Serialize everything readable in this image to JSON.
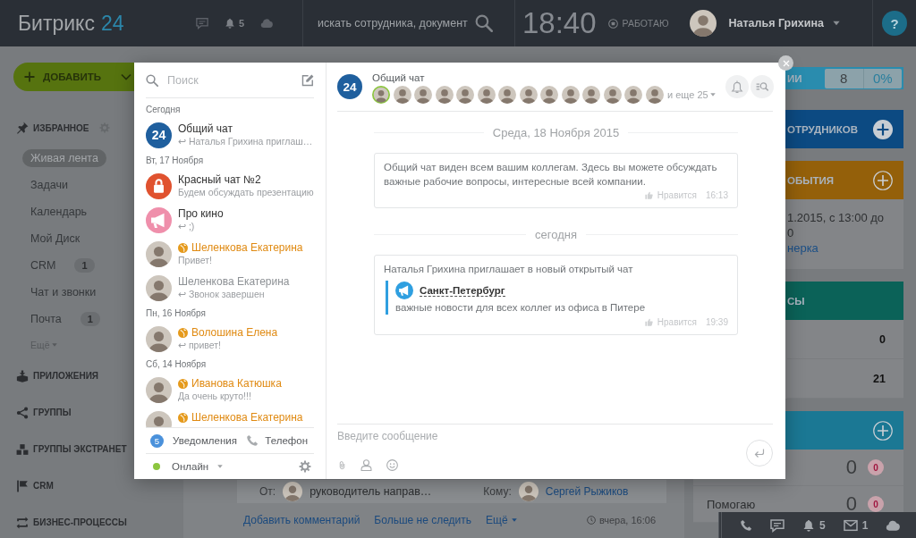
{
  "top_bar": {
    "logo": {
      "name": "Битрикс",
      "number": "24"
    },
    "notifications_count": "5",
    "search": {
      "placeholder": "искать сотрудника, документ"
    },
    "time": "18:40",
    "work_status": "РАБОТАЮ",
    "user": "Наталья Грихина",
    "help": "?"
  },
  "sidebar": {
    "add_button": "ДОБАВИТЬ",
    "favorites": {
      "title": "ИЗБРАННОЕ",
      "items": [
        {
          "label": "Живая лента",
          "selected": true
        },
        {
          "label": "Задачи",
          "selected": false
        },
        {
          "label": "Календарь",
          "selected": false
        },
        {
          "label": "Мой Диск",
          "selected": false
        },
        {
          "label": "CRM",
          "selected": false,
          "counter": "1"
        },
        {
          "label": "Чат и звонки",
          "selected": false
        },
        {
          "label": "Почта",
          "selected": false,
          "counter": "1"
        }
      ],
      "more": "Ещё"
    },
    "sections": [
      "ПРИЛОЖЕНИЯ",
      "ГРУППЫ",
      "ГРУППЫ ЭКСТРАНЕТ",
      "CRM",
      "БИЗНЕС-ПРОЦЕССЫ"
    ]
  },
  "feed_post": {
    "from_label": "От:",
    "from_role": "руководитель направ…",
    "to_label": "Кому:",
    "to_name": "Сергей Рыжиков",
    "actions": [
      "Добавить комментарий",
      "Больше не следить"
    ],
    "more": "Ещё",
    "time": "вчера, 16:06"
  },
  "right_column": {
    "widgets": [
      {
        "kind": "bar",
        "title": "ИИ",
        "color": "#2a8cae",
        "stats": [
          "8",
          "0%"
        ],
        "add": false
      },
      {
        "kind": "bar",
        "title": "ОТРУДНИКОВ",
        "color": "#0c4a82",
        "add": true,
        "filled": true
      },
      {
        "kind": "bar",
        "title": "ОБЫТИЯ",
        "color": "#94600a",
        "add": true,
        "filled": false
      },
      {
        "kind": "event",
        "lines": [
          "1.2015, с 13:00 до",
          "0"
        ],
        "link": "нерка"
      },
      {
        "kind": "bar",
        "title": "СЫ",
        "color": "#0b6258",
        "add": false
      },
      {
        "kind": "values",
        "rows": [
          "0",
          "21"
        ]
      },
      {
        "kind": "bar",
        "color": "#1b7894",
        "add": true,
        "filled": false
      },
      {
        "kind": "counters",
        "rows": [
          {
            "value": "0",
            "badge": "0"
          },
          {
            "label": "Помогаю",
            "value": "0",
            "badge": "0"
          }
        ]
      }
    ]
  },
  "messenger": {
    "search": {
      "placeholder": "Поиск"
    },
    "groups": [
      {
        "date": "Сегодня",
        "chats": [
          {
            "kind": "general",
            "avatar_text": "24",
            "name": "Общий чат",
            "preview": "↩ Наталья Грихина приглаш…",
            "extranet": false,
            "faded": false
          }
        ]
      },
      {
        "date": "Вт, 17 Ноября",
        "chats": [
          {
            "kind": "private",
            "name": "Красный чат №2",
            "preview": "Будем обсуждать презентацию",
            "extranet": false,
            "faded": false
          },
          {
            "kind": "open",
            "name": "Про кино",
            "preview": "↩ ;)",
            "extranet": false,
            "faded": false
          },
          {
            "kind": "user",
            "name": "Шеленкова Екатерина",
            "preview": "Привет!",
            "extranet": true,
            "faded": false
          },
          {
            "kind": "user",
            "name": "Шеленкова Екатерина",
            "preview": "↩ Звонок завершен",
            "extranet": false,
            "faded": true
          }
        ]
      },
      {
        "date": "Пн, 16 Ноября",
        "chats": [
          {
            "kind": "user",
            "name": "Волошина Елена",
            "preview": "↩ привет!",
            "extranet": true,
            "faded": false
          }
        ]
      },
      {
        "date": "Сб, 14 Ноября",
        "chats": [
          {
            "kind": "user",
            "name": "Иванова Катюшка",
            "preview": "Да очень круто!!!",
            "extranet": true,
            "faded": false
          },
          {
            "kind": "user",
            "name": "Шеленкова Екатерина",
            "extranet": true,
            "faded": false
          }
        ]
      }
    ],
    "footer": {
      "notifications_count": "5",
      "notifications": "Уведомления",
      "phone": "Телефон",
      "status": "Онлайн"
    },
    "chat": {
      "avatar_text": "24",
      "title": "Общий чат",
      "members": [
        {
          "online": true
        },
        {
          "online": false
        },
        {
          "online": false
        },
        {
          "online": false
        },
        {
          "online": false
        },
        {
          "online": false
        },
        {
          "online": false
        },
        {
          "online": false
        },
        {
          "online": false
        },
        {
          "online": false
        },
        {
          "online": false
        },
        {
          "online": false
        },
        {
          "online": false
        },
        {
          "online": false
        }
      ],
      "more_members": "и еще 25",
      "messages": [
        {
          "kind": "date",
          "text": "Среда, 18 Ноября 2015"
        },
        {
          "kind": "message",
          "text": "Общий чат виден всем вашим коллегам. Здесь вы можете обсуждать важные рабочие вопросы, интересные всей компании.",
          "like": "Нравится",
          "time": "16:13"
        },
        {
          "kind": "date",
          "text": "сегодня"
        },
        {
          "kind": "invite",
          "text": "Наталья Грихина приглашает в новый открытый чат",
          "chat_name": "Санкт-Петербург",
          "chat_description": "важные новости для всех коллег из офиса в Питере",
          "like": "Нравится",
          "time": "19:39"
        }
      ],
      "input": {
        "placeholder": "Введите сообщение"
      }
    }
  },
  "bottom_bar": {
    "notifications_count": "5",
    "messages_count": "1"
  }
}
